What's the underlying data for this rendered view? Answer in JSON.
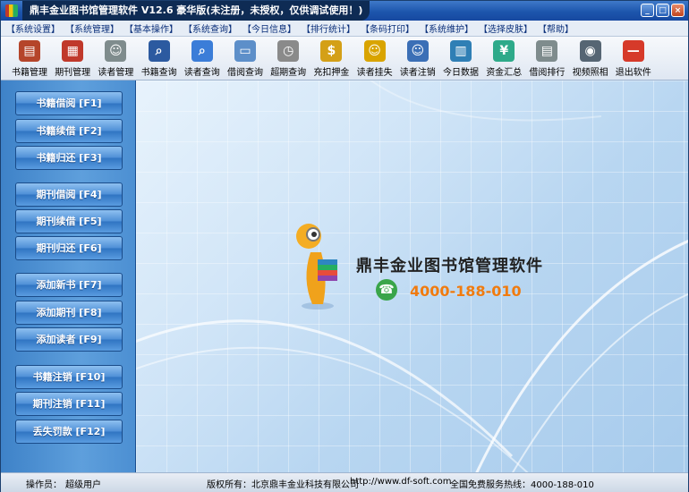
{
  "window": {
    "title": "鼎丰金业图书馆管理软件 V12.6 豪华版(未注册，未授权，仅供调试使用！)",
    "controls": [
      "_",
      "□",
      "×"
    ]
  },
  "menu": [
    "【系统设置】",
    "【系统管理】",
    "【基本操作】",
    "【系统查询】",
    "【今日信息】",
    "【排行统计】",
    "【条码打印】",
    "【系统维护】",
    "【选择皮肤】",
    "【帮助】"
  ],
  "toolbar": [
    {
      "label": "书籍管理",
      "icon": "books-icon",
      "color": "#b5452a",
      "glyph": "▤"
    },
    {
      "label": "期刊管理",
      "icon": "magazine-icon",
      "color": "#c0392b",
      "glyph": "▦"
    },
    {
      "label": "读者管理",
      "icon": "reader-card-icon",
      "color": "#7f8c8d",
      "glyph": "☺"
    },
    {
      "label": "书籍查询",
      "icon": "book-search-icon",
      "color": "#2c5aa0",
      "glyph": "⌕"
    },
    {
      "label": "读者查询",
      "icon": "reader-search-icon",
      "color": "#3b7dd8",
      "glyph": "⌕"
    },
    {
      "label": "借阅查询",
      "icon": "borrow-search-icon",
      "color": "#5d8fc9",
      "glyph": "▭"
    },
    {
      "label": "超期查询",
      "icon": "clock-icon",
      "color": "#8a8a8a",
      "glyph": "◷"
    },
    {
      "label": "充扣押金",
      "icon": "deposit-icon",
      "color": "#d4a017",
      "glyph": "$"
    },
    {
      "label": "读者挂失",
      "icon": "reader-lock-icon",
      "color": "#d9a400",
      "glyph": "☺"
    },
    {
      "label": "读者注销",
      "icon": "reader-cancel-icon",
      "color": "#3b6fb6",
      "glyph": "☺"
    },
    {
      "label": "今日数据",
      "icon": "today-data-icon",
      "color": "#2f7fb5",
      "glyph": "▥"
    },
    {
      "label": "资金汇总",
      "icon": "yen-icon",
      "color": "#2eaa8a",
      "glyph": "¥"
    },
    {
      "label": "借阅排行",
      "icon": "ranking-icon",
      "color": "#7f8c8d",
      "glyph": "▤"
    },
    {
      "label": "视频照相",
      "icon": "camera-icon",
      "color": "#566573",
      "glyph": "◉"
    },
    {
      "label": "退出软件",
      "icon": "exit-icon",
      "color": "#d63a2a",
      "glyph": "—"
    }
  ],
  "sidebar": [
    "书籍借阅 [F1]",
    "书籍续借 [F2]",
    "书籍归还 [F3]",
    "期刊借阅 [F4]",
    "期刊续借 [F5]",
    "期刊归还 [F6]",
    "添加新书 [F7]",
    "添加期刊 [F8]",
    "添加读者 [F9]",
    "书籍注销 [F10]",
    "期刊注销 [F11]",
    "丢失罚款 [F12]"
  ],
  "brand": {
    "name": "鼎丰金业图书馆管理软件",
    "phone": "4000-188-010"
  },
  "status": {
    "operator_label": "操作员：",
    "operator_value": "超级用户",
    "copyright": "版权所有：北京鼎丰金业科技有限公司",
    "website": "http://www.df-soft.com",
    "hotline": "全国免费服务热线：4000-188-010"
  },
  "colors": {
    "title_bar": "#1d56ad",
    "sidebar": "#4c8fd2",
    "phone_number": "#f07b0f",
    "menu_text": "#0a2f7a"
  }
}
